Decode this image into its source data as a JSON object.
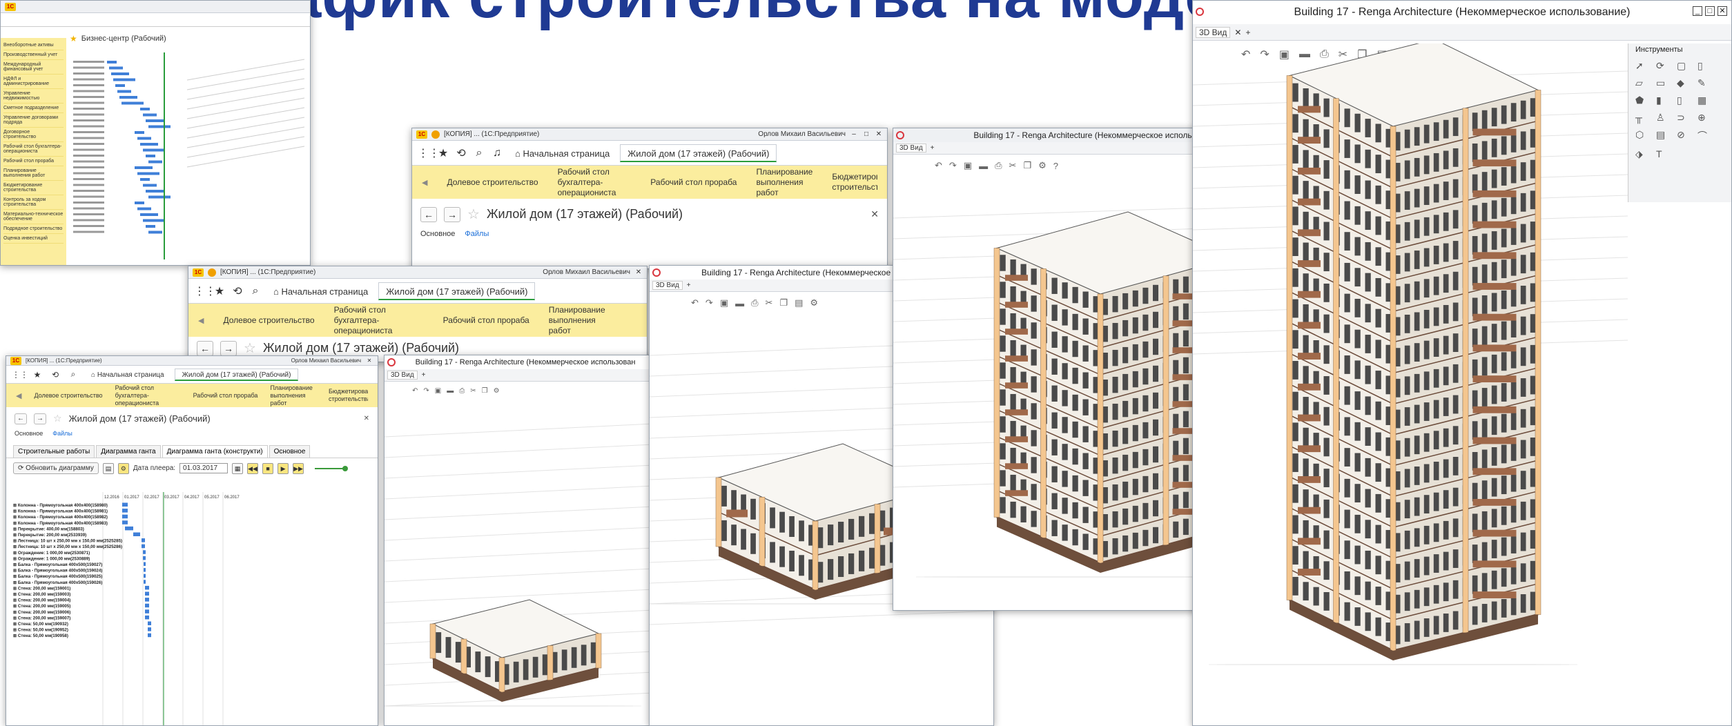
{
  "headline": "...ной график строительства на модели",
  "app_1c": {
    "title_copy": "[КОПИЯ] ... (1С:Предприятие)",
    "user": "Орлов Михаил Васильевич",
    "home_tab": "Начальная страница",
    "doc_tab": "Жилой дом (17 этажей) (Рабочий)",
    "doc_tab_old": "Бизнес-центр (Рабочий)",
    "sections": [
      "Долевое строительство",
      "Рабочий стол бухгалтера-операциониста",
      "Рабочий стол прораба",
      "Планирование выполнения работ",
      "Бюджетирование строительства"
    ],
    "form_title": "Жилой дом (17 этажей) (Рабочий)",
    "form_title_old": "Бизнес-центр (Рабочий)",
    "subnav": {
      "main": "Основное",
      "files": "Файлы"
    },
    "page_tabs": [
      "Строительные работы",
      "Диаграмма ганта",
      "Диаграмма ганта (конструкти)",
      "Основное"
    ],
    "refresh_label": "Обновить диаграмму",
    "date_label": "Дата плеера:",
    "date_value": "01.03.2017",
    "months": [
      "12.2016",
      "01.2017",
      "02.2017",
      "03.2017",
      "04.2017",
      "05.2017",
      "06.2017"
    ],
    "rows": [
      "Колонна - Прямоугольная 400x400(158980)",
      "Колонна - Прямоугольная 400x400(158981)",
      "Колонна - Прямоугольная 400x400(158982)",
      "Колонна - Прямоугольная 400x400(158983)",
      "Перекрытие: 400,00 мм(158803)",
      "Перекрытие: 200,00 мм(2533939)",
      "Лестница: 10 шт x 250,00 мм x 150,00 мм(2525285)",
      "Лестница: 10 шт x 250,00 мм x 150,00 мм(2525286)",
      "Ограждение: 1 000,00 мм(2530871)",
      "Ограждение: 1 000,00 мм(2530889)",
      "Балка - Прямоугольная 400x500(159027)",
      "Балка - Прямоугольная 400x500(159024)",
      "Балка - Прямоугольная 400x500(159025)",
      "Балка - Прямоугольная 400x500(159026)",
      "Стена: 200,00 мм(159001)",
      "Стена: 200,00 мм(159003)",
      "Стена: 200,00 мм(159004)",
      "Стена: 200,00 мм(159005)",
      "Стена: 200,00 мм(159006)",
      "Стена: 200,00 мм(159007)",
      "Стена: 50,00 мм(190932)",
      "Стена: 50,00 мм(190952)",
      "Стена: 50,00 мм(190958)"
    ],
    "left_menu": [
      "Внеоборотные активы",
      "Производственный учет",
      "Международный финансовый учет",
      "НДФЛ и администрирование",
      "Управление недвижимостью",
      "Сметное подразделение",
      "Управление договорами подряда",
      "Договорное строительство",
      "Рабочий стол бухгалтера-операциониста",
      "Рабочий стол прораба",
      "Планирование выполнения работ",
      "Бюджетирование строительства",
      "Контроль за ходом строительства",
      "Материально-техническое обеспечение",
      "Подрядное строительство",
      "Оценка инвестиций"
    ]
  },
  "app_renga": {
    "title": "Building 17 - Renga Architecture (Некоммерческое использование)",
    "title_short": "Building 17 - Renga Architecture (Некоммерческое использован",
    "view_tab": "3D Вид",
    "tools_label": "Инструменты",
    "tools_icons": [
      "cursor-icon",
      "rotate-icon",
      "box-icon",
      "column-icon",
      "wall-icon",
      "beam-icon",
      "slab-icon",
      "roof-icon",
      "door-icon",
      "window-icon",
      "stair-icon",
      "railing-icon",
      "text-icon"
    ]
  },
  "colors": {
    "yellow_bar": "#fbed9e",
    "gantt_bar": "#3f7fd8",
    "green_line": "#2a9d3c",
    "title_blue": "#1f3a93"
  }
}
